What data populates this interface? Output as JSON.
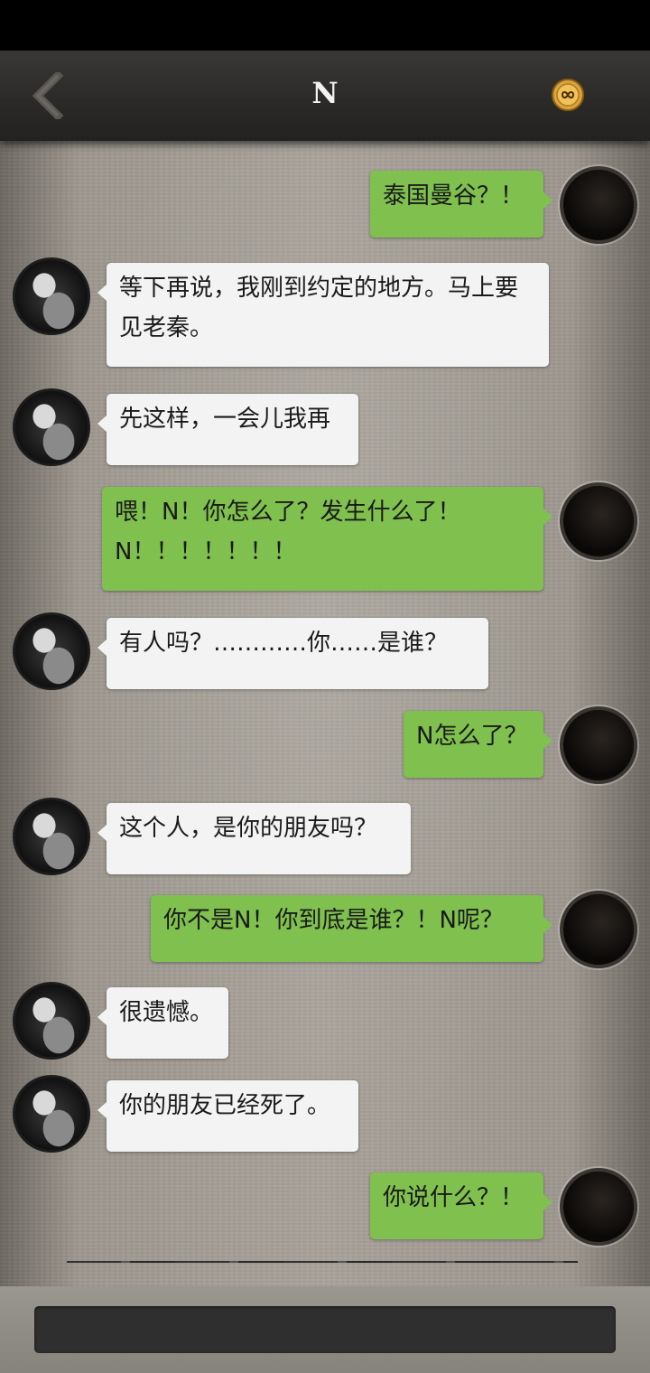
{
  "header": {
    "title": "N",
    "back_icon": "chevron-left-icon",
    "menu_icon": "infinity-badge-icon"
  },
  "messages": [
    {
      "sender": "me",
      "text": "泰国曼谷？！"
    },
    {
      "sender": "them",
      "text": "等下再说，我刚到约定的地方。马上要见老秦。"
    },
    {
      "sender": "them",
      "text": "先这样，一会儿我再"
    },
    {
      "sender": "me",
      "text": "喂！N！你怎么了？发生什么了！N！！！！！！！"
    },
    {
      "sender": "them",
      "text": "有人吗？…………你……是谁？"
    },
    {
      "sender": "me",
      "text": "N怎么了？"
    },
    {
      "sender": "them",
      "text": "这个人，是你的朋友吗？"
    },
    {
      "sender": "me",
      "text": "你不是N！你到底是谁？！N呢？"
    },
    {
      "sender": "them",
      "text": "很遗憾。"
    },
    {
      "sender": "them",
      "text": "你的朋友已经死了。"
    },
    {
      "sender": "me",
      "text": "你说什么？！"
    }
  ],
  "input": {
    "placeholder": ""
  },
  "colors": {
    "outgoing_bubble": "#7fc04e",
    "incoming_bubble": "#f3f3f3",
    "header": "#2b2927"
  }
}
